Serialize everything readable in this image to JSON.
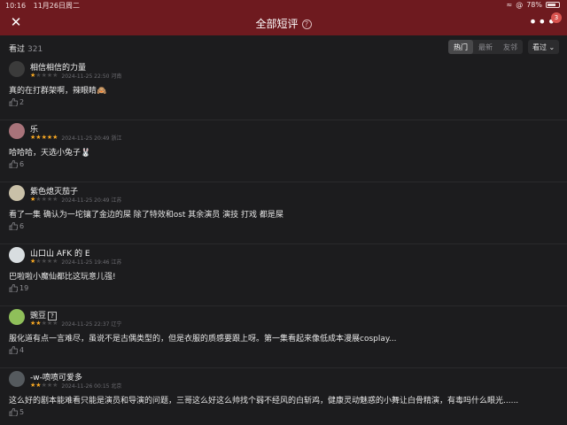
{
  "status": {
    "time": "10:16",
    "date": "11月26日周二",
    "battery": "78%",
    "battery_level": 0.78
  },
  "nav": {
    "title": "全部短评",
    "help": "?",
    "badge": "3"
  },
  "filter": {
    "seen_label": "看过",
    "seen_count": "321",
    "tabs": [
      "热门",
      "最新",
      "友邻"
    ],
    "active_tab": 0,
    "sort_label": "看过"
  },
  "colors": {
    "accent": "#6e1a1f",
    "star": "#f5a623"
  },
  "reviews": [
    {
      "user": "相信相信的力量",
      "rating": 1,
      "meta": "2024-11-25 22:50 河南",
      "content": "真的在打群架啊，辣眼睛🙈",
      "likes": "2",
      "avatar_color": "#3b3b3b"
    },
    {
      "user": "乐",
      "rating": 5,
      "meta": "2024-11-25 20:49 浙江",
      "content": "哈哈哈，天选小兔子🐰",
      "likes": "6",
      "avatar_color": "#a8737a"
    },
    {
      "user": "紫色熄灭茄子",
      "rating": 1,
      "meta": "2024-11-25 20:49 江苏",
      "content": "看了一集 确认为一坨镶了金边的屎 除了特效和ost 其余演员 演技 打戏 都是屎",
      "likes": "6",
      "avatar_color": "#c9c0a8"
    },
    {
      "user": "山口山 AFK 的 E",
      "rating": 1,
      "meta": "2024-11-25 19:46 江苏",
      "content": "巴啦啦小魔仙都比这玩意儿强!",
      "likes": "19",
      "avatar_color": "#d8dde0"
    },
    {
      "user": "豌豆",
      "tag": "?",
      "rating": 2,
      "meta": "2024-11-25 22:37 辽宁",
      "content": "服化道有点一言难尽，虽说不是古偶类型的，但是衣服的质感要跟上呀。第一集看起来像低成本漫展cosplay...",
      "likes": "4",
      "avatar_color": "#8fbf5a"
    },
    {
      "user": "-w-喷喷可爱多",
      "rating": 2,
      "meta": "2024-11-26 00:15 北京",
      "content": "这么好的剧本能难看只能是演员和导演的问题，三哥这么好这么帅找个弱不经风的白斩鸡，健康灵动魅惑的小舞让白骨精演，有毒吗什么眼光......",
      "likes": "5",
      "avatar_color": "#555a5e"
    }
  ]
}
